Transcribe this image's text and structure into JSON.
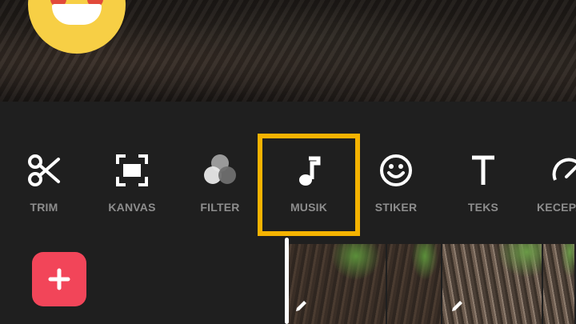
{
  "toolbar": {
    "tools": [
      {
        "label": "TRIM",
        "icon": "scissors-icon"
      },
      {
        "label": "KANVAS",
        "icon": "canvas-frame-icon"
      },
      {
        "label": "FILTER",
        "icon": "filter-circles-icon"
      },
      {
        "label": "MUSIK",
        "icon": "music-note-icon",
        "selected": true
      },
      {
        "label": "STIKER",
        "icon": "smiley-icon"
      },
      {
        "label": "TEKS",
        "icon": "text-t-icon"
      },
      {
        "label": "KECEPA",
        "icon": "speed-gauge-icon"
      }
    ],
    "selected_color": "#f5b301"
  },
  "timeline": {
    "add_button_color": "#f24559",
    "add_icon": "plus-icon",
    "clips": [
      {
        "icon": "pencil-icon"
      },
      {
        "icon": "pencil-icon"
      }
    ]
  }
}
